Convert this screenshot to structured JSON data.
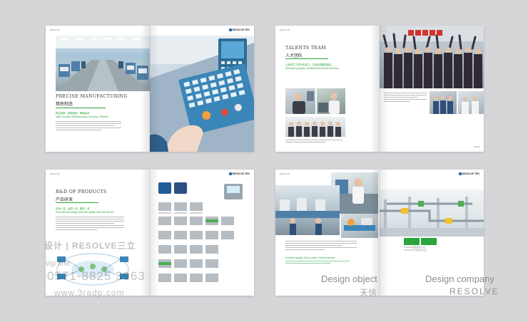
{
  "spread1": {
    "left_logo": "RESOLVE",
    "right_logo": "RESOLVE TEK",
    "title_en": "PRECISE MANUFACTURING",
    "title_cn": "精密制造",
    "green_line1": "精益求精，精细制造，精确高效",
    "green_line2": "High Precision Manufacturing, Accuracy, Efficient"
  },
  "spread2": {
    "header": "RESOLVE",
    "title_en": "TALENTS TEAM",
    "title_cn": "人才团队",
    "green_line1": "以我们员工的专业能力，打造优质服务团队",
    "green_line2": "Winning by people, professional and service team",
    "page_num": "12  13"
  },
  "spread3": {
    "header": "RESOLVE",
    "right_logo": "RESOLVE TEK",
    "title_en": "R&D OF PRODUCTS",
    "title_cn": "产品研发",
    "green_line1": "技术一流，品质一流，服务一流",
    "green_line2": "First-rate technology, first-rate quality, first-rate service"
  },
  "spread4": {
    "header": "RESOLVE",
    "right_logo": "RESOLVE TEK",
    "green_box1": "ISO9001质量体系认证",
    "green_box2": "ISO14001环境体系认证",
    "green_para_en": "Excellent quality, Strict control, Perfect service"
  },
  "watermark": {
    "line1": "设计 | RESOLVE三立",
    "line2": "vip line",
    "line3": "0571-8825 3963",
    "line4": "www.3radp.com"
  },
  "captions": {
    "design_object": "Design object",
    "design_object_cn": "天信",
    "design_company": "Design company",
    "design_company_brand": "RESOLVE"
  },
  "colors": {
    "accent_green": "#2aa53b",
    "background": "#d6d6d9",
    "factory_blue": "#5a9ec9"
  }
}
